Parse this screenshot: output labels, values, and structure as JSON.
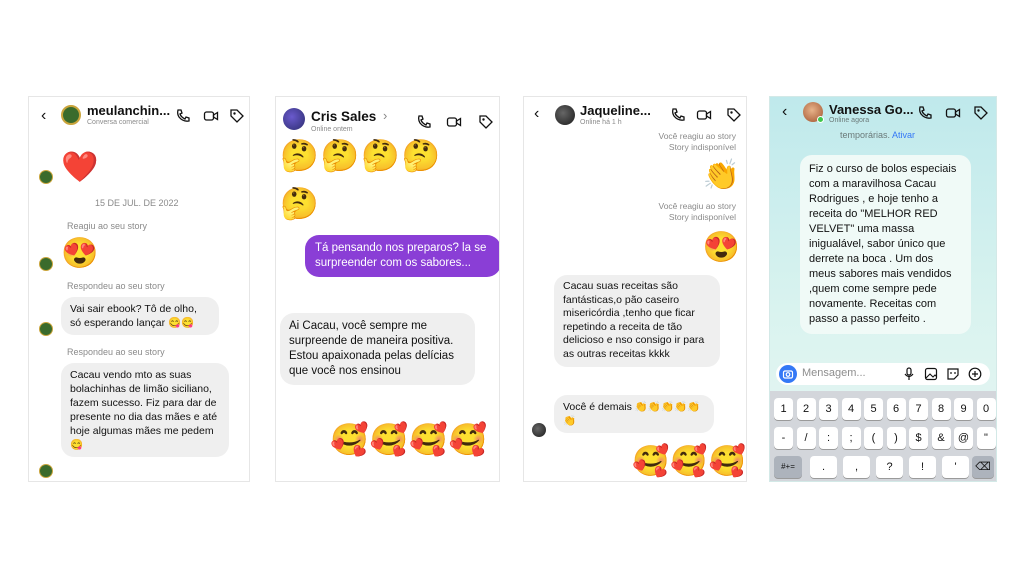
{
  "panel1": {
    "name": "meulanchin...",
    "subtitle": "Conversa comercial",
    "date": "15 DE JUL. DE 2022",
    "heart": "❤️",
    "meta1": "Reagiu ao seu story",
    "emoji1": "😍",
    "meta2": "Respondeu ao seu story",
    "msg1": "Vai sair ebook? Tô de olho, só esperando lançar 😋😋",
    "meta3": "Respondeu ao seu story",
    "msg2": "Cacau vendo mto as suas bolachinhas de limão siciliano, fazem sucesso. Fiz para dar de presente no dia das mães e até hoje algumas mães me pedem 😋"
  },
  "panel2": {
    "name": "Cris Sales",
    "chevron": "›",
    "subtitle": "Online ontem",
    "thinking_row": "🤔🤔🤔🤔",
    "thinking_single": "🤔",
    "msg_sent": "Tá pensando nos preparos? la se surpreender com os sabores...",
    "msg_recv": "Ai Cacau, você sempre me surpreende de maneira positiva. Estou apaixonada pelas delícias que você nos ensinou",
    "emoji_row": "🥰🥰🥰🥰"
  },
  "panel3": {
    "name": "Jaqueline...",
    "subtitle": "Online há 1 h",
    "meta_top1": "Você reagiu ao story",
    "meta_top2": "Story indisponível",
    "clap": "👏",
    "meta_mid1": "Você reagiu ao story",
    "meta_mid2": "Story indisponível",
    "emoji_heart": "😍",
    "msg1": "Cacau suas receitas são fantásticas,o pão caseiro misericórdia ,tenho que ficar repetindo a receita de tão delicioso e nso consigo ir para as outras receitas kkkk",
    "msg2": "Você é demais 👏👏👏👏👏👏",
    "emoji_row": "🥰🥰🥰"
  },
  "panel4": {
    "name": "Vanessa Go...",
    "subtitle": "Online agora",
    "top_text": "temporárias.",
    "top_link": "Ativar",
    "msg": "Fiz o curso de bolos especiais com a maravilhosa Cacau Rodrigues , e hoje tenho a receita do \"MELHOR RED VELVET\" uma massa inigualável, sabor único que derrete na boca . Um dos meus sabores mais vendidos ,quem come sempre pede novamente. Receitas com passo a passo perfeito .",
    "input_placeholder": "Mensagem...",
    "keys_row1": [
      "1",
      "2",
      "3",
      "4",
      "5",
      "6",
      "7",
      "8",
      "9",
      "0"
    ],
    "keys_row2": [
      "-",
      "/",
      ":",
      ";",
      "(",
      ")",
      "$",
      "&",
      "@",
      "\""
    ],
    "keys_row3": [
      "#+=",
      ".",
      ",",
      "?",
      "!",
      "'",
      "⌫"
    ]
  },
  "colors": {
    "sent_bubble": "#8a3ed6",
    "received_bubble": "#efefef",
    "online_green": "#3ec64a",
    "link_blue": "#3478f6"
  }
}
